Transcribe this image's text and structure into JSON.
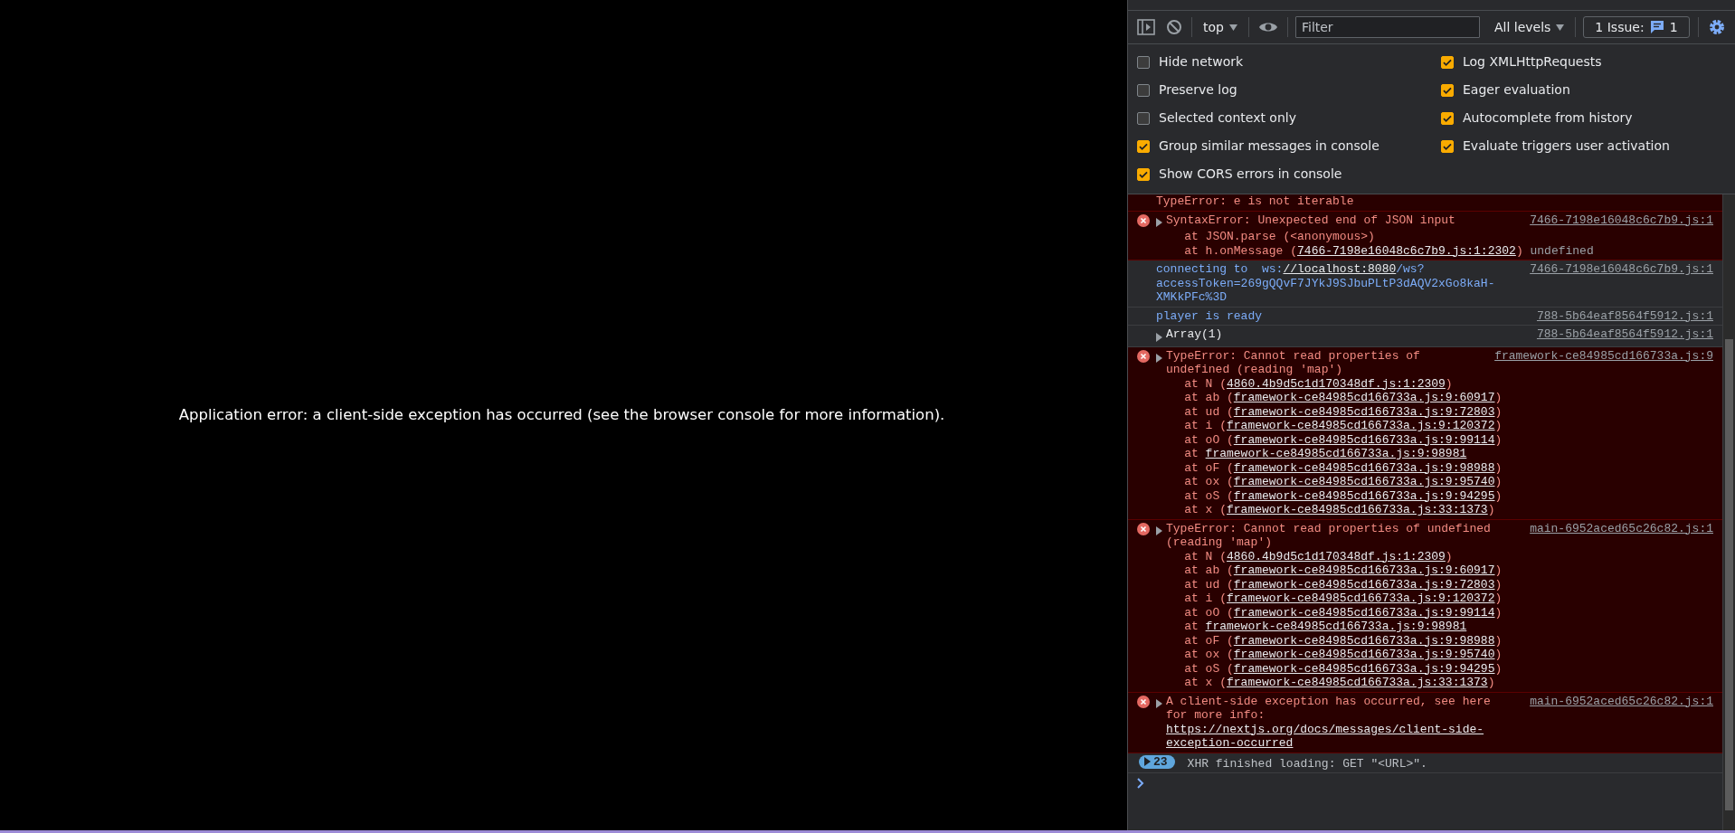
{
  "page": {
    "error_message": "Application error: a client-side exception has occurred (see the browser console for more information)."
  },
  "devtools": {
    "toolbar": {
      "context": "top",
      "filter_placeholder": "Filter",
      "levels": "All levels",
      "issues_label": "1 Issue:",
      "issues_count": "1"
    },
    "settings_left": [
      {
        "label": "Hide network",
        "checked": false
      },
      {
        "label": "Preserve log",
        "checked": false
      },
      {
        "label": "Selected context only",
        "checked": false
      },
      {
        "label": "Group similar messages in console",
        "checked": true
      },
      {
        "label": "Show CORS errors in console",
        "checked": true
      }
    ],
    "settings_right": [
      {
        "label": "Log XMLHttpRequests",
        "checked": true
      },
      {
        "label": "Eager evaluation",
        "checked": true
      },
      {
        "label": "Autocomplete from history",
        "checked": true
      },
      {
        "label": "Evaluate triggers user activation",
        "checked": true
      }
    ],
    "messages": [
      {
        "kind": "error",
        "continued": true,
        "expandable": false,
        "text": [
          {
            "kind": "text",
            "text": "TypeError: e is not iterable"
          }
        ]
      },
      {
        "kind": "error",
        "continued": false,
        "expandable": true,
        "source": "7466-7198e16048c6c7b9.js:1",
        "text": [
          {
            "kind": "text",
            "text": "SyntaxError: Unexpected end of JSON input"
          }
        ],
        "stack": [
          [
            {
              "kind": "text",
              "text": "at JSON.parse (<anonymous>)"
            }
          ],
          [
            {
              "kind": "text",
              "text": "at h.onMessage ("
            },
            {
              "kind": "link",
              "text": "7466-7198e16048c6c7b9.js:1:2302"
            },
            {
              "kind": "text",
              "text": ")"
            },
            {
              "kind": "muted",
              "text": " undefined"
            }
          ]
        ]
      },
      {
        "kind": "info",
        "continued": false,
        "expandable": false,
        "source": "7466-7198e16048c6c7b9.js:1",
        "text": [
          {
            "kind": "text",
            "text": "connecting to  ws:"
          },
          {
            "kind": "link",
            "text": "//localhost:8080"
          },
          {
            "kind": "text",
            "text": "/ws?accessToken=269gQQvF7JYkJ9SJbuPLtP3dAQV2xGo8kaH-XMKkPFc%3D"
          }
        ]
      },
      {
        "kind": "info",
        "continued": false,
        "expandable": false,
        "source": "788-5b64eaf8564f5912.js:1",
        "text": [
          {
            "kind": "text",
            "text": "player is ready"
          }
        ]
      },
      {
        "kind": "log",
        "continued": false,
        "expandable": true,
        "source": "788-5b64eaf8564f5912.js:1",
        "text": [
          {
            "kind": "text",
            "text": "Array(1)"
          }
        ]
      },
      {
        "kind": "error",
        "continued": false,
        "expandable": true,
        "source": "framework-ce84985cd166733a.js:9",
        "text": [
          {
            "kind": "text",
            "text": "TypeError: Cannot read properties of undefined (reading 'map')"
          }
        ],
        "stack": [
          [
            {
              "kind": "text",
              "text": "at N ("
            },
            {
              "kind": "link",
              "text": "4860.4b9d5c1d170348df.js:1:2309"
            },
            {
              "kind": "text",
              "text": ")"
            }
          ],
          [
            {
              "kind": "text",
              "text": "at ab ("
            },
            {
              "kind": "link",
              "text": "framework-ce84985cd166733a.js:9:60917"
            },
            {
              "kind": "text",
              "text": ")"
            }
          ],
          [
            {
              "kind": "text",
              "text": "at ud ("
            },
            {
              "kind": "link",
              "text": "framework-ce84985cd166733a.js:9:72803"
            },
            {
              "kind": "text",
              "text": ")"
            }
          ],
          [
            {
              "kind": "text",
              "text": "at i ("
            },
            {
              "kind": "link",
              "text": "framework-ce84985cd166733a.js:9:120372"
            },
            {
              "kind": "text",
              "text": ")"
            }
          ],
          [
            {
              "kind": "text",
              "text": "at oO ("
            },
            {
              "kind": "link",
              "text": "framework-ce84985cd166733a.js:9:99114"
            },
            {
              "kind": "text",
              "text": ")"
            }
          ],
          [
            {
              "kind": "text",
              "text": "at "
            },
            {
              "kind": "link",
              "text": "framework-ce84985cd166733a.js:9:98981"
            }
          ],
          [
            {
              "kind": "text",
              "text": "at oF ("
            },
            {
              "kind": "link",
              "text": "framework-ce84985cd166733a.js:9:98988"
            },
            {
              "kind": "text",
              "text": ")"
            }
          ],
          [
            {
              "kind": "text",
              "text": "at ox ("
            },
            {
              "kind": "link",
              "text": "framework-ce84985cd166733a.js:9:95740"
            },
            {
              "kind": "text",
              "text": ")"
            }
          ],
          [
            {
              "kind": "text",
              "text": "at oS ("
            },
            {
              "kind": "link",
              "text": "framework-ce84985cd166733a.js:9:94295"
            },
            {
              "kind": "text",
              "text": ")"
            }
          ],
          [
            {
              "kind": "text",
              "text": "at x ("
            },
            {
              "kind": "link",
              "text": "framework-ce84985cd166733a.js:33:1373"
            },
            {
              "kind": "text",
              "text": ")"
            }
          ]
        ]
      },
      {
        "kind": "error",
        "continued": false,
        "expandable": true,
        "source": "main-6952aced65c26c82.js:1",
        "text": [
          {
            "kind": "text",
            "text": "TypeError: Cannot read properties of undefined (reading 'map')"
          }
        ],
        "stack": [
          [
            {
              "kind": "text",
              "text": "at N ("
            },
            {
              "kind": "link",
              "text": "4860.4b9d5c1d170348df.js:1:2309"
            },
            {
              "kind": "text",
              "text": ")"
            }
          ],
          [
            {
              "kind": "text",
              "text": "at ab ("
            },
            {
              "kind": "link",
              "text": "framework-ce84985cd166733a.js:9:60917"
            },
            {
              "kind": "text",
              "text": ")"
            }
          ],
          [
            {
              "kind": "text",
              "text": "at ud ("
            },
            {
              "kind": "link",
              "text": "framework-ce84985cd166733a.js:9:72803"
            },
            {
              "kind": "text",
              "text": ")"
            }
          ],
          [
            {
              "kind": "text",
              "text": "at i ("
            },
            {
              "kind": "link",
              "text": "framework-ce84985cd166733a.js:9:120372"
            },
            {
              "kind": "text",
              "text": ")"
            }
          ],
          [
            {
              "kind": "text",
              "text": "at oO ("
            },
            {
              "kind": "link",
              "text": "framework-ce84985cd166733a.js:9:99114"
            },
            {
              "kind": "text",
              "text": ")"
            }
          ],
          [
            {
              "kind": "text",
              "text": "at "
            },
            {
              "kind": "link",
              "text": "framework-ce84985cd166733a.js:9:98981"
            }
          ],
          [
            {
              "kind": "text",
              "text": "at oF ("
            },
            {
              "kind": "link",
              "text": "framework-ce84985cd166733a.js:9:98988"
            },
            {
              "kind": "text",
              "text": ")"
            }
          ],
          [
            {
              "kind": "text",
              "text": "at ox ("
            },
            {
              "kind": "link",
              "text": "framework-ce84985cd166733a.js:9:95740"
            },
            {
              "kind": "text",
              "text": ")"
            }
          ],
          [
            {
              "kind": "text",
              "text": "at oS ("
            },
            {
              "kind": "link",
              "text": "framework-ce84985cd166733a.js:9:94295"
            },
            {
              "kind": "text",
              "text": ")"
            }
          ],
          [
            {
              "kind": "text",
              "text": "at x ("
            },
            {
              "kind": "link",
              "text": "framework-ce84985cd166733a.js:33:1373"
            },
            {
              "kind": "text",
              "text": ")"
            }
          ]
        ]
      },
      {
        "kind": "error",
        "continued": false,
        "expandable": true,
        "source": "main-6952aced65c26c82.js:1",
        "text": [
          {
            "kind": "text",
            "text": "A client-side exception has occurred, see here for more info: "
          },
          {
            "kind": "link",
            "text": "https://nextjs.org/docs/messages/client-side-exception-occurred"
          }
        ]
      },
      {
        "kind": "group",
        "continued": false,
        "expandable": true,
        "count": "23",
        "text": [
          {
            "kind": "text",
            "text": "XHR finished loading: GET \"<URL>\"."
          }
        ]
      }
    ]
  }
}
